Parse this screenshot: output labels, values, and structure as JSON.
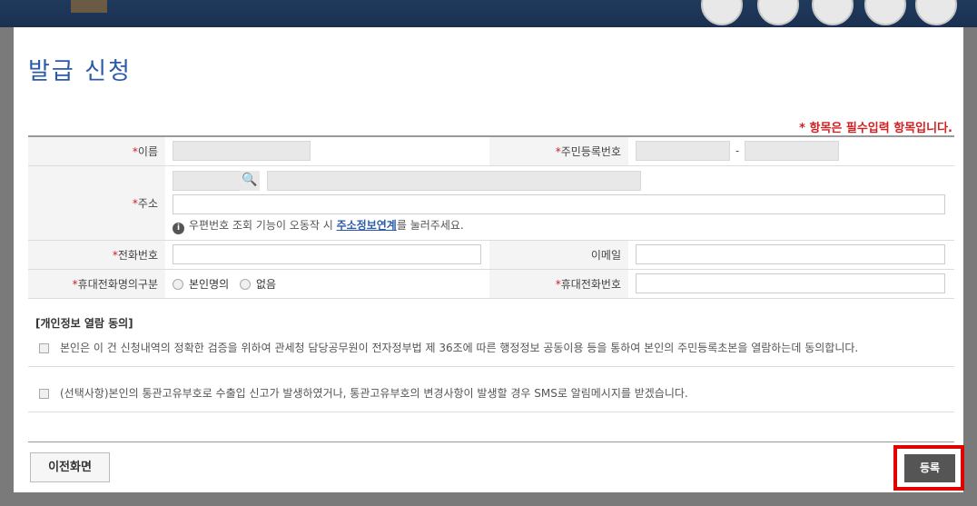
{
  "modal": {
    "title": "발급 신청",
    "required_note": "* 항목은 필수입력 항목입니다."
  },
  "form": {
    "name_label": "이름",
    "rrn_label": "주민등록번호",
    "rrn_separator": "-",
    "address_label": "주소",
    "address_info_prefix": "우편번호 조회 기능이 오동작 시 ",
    "address_info_link": "주소정보연계",
    "address_info_suffix": "를 눌러주세요.",
    "phone_label": "전화번호",
    "email_label": "이메일",
    "mobile_type_label": "휴대전화명의구분",
    "mobile_type_options": [
      "본인명의",
      "없음"
    ],
    "mobile_label": "휴대전화번호",
    "required_mark": "*",
    "info_icon_glyph": "i",
    "search_icon_glyph": "🔍"
  },
  "consent": {
    "title": "[개인정보 열람 동의]",
    "items": [
      "본인은 이 건 신청내역의 정확한 검증을 위하여 관세청 담당공무원이 전자정부법 제 36조에 따른 행정정보 공동이용 등을 통하여 본인의 주민등록초본을 열람하는데 동의합니다.",
      "(선택사항)본인의 통관고유부호로 수출입 신고가 발생하였거나, 통관고유부호의 변경사항이 발생할 경우 SMS로 알림메시지를 받겠습니다."
    ]
  },
  "footer": {
    "prev_label": "이전화면",
    "register_label": "등록"
  },
  "colors": {
    "title": "#2a5aa8",
    "required": "#d21f1f",
    "highlight": "#e00000",
    "register_bg": "#555555"
  }
}
